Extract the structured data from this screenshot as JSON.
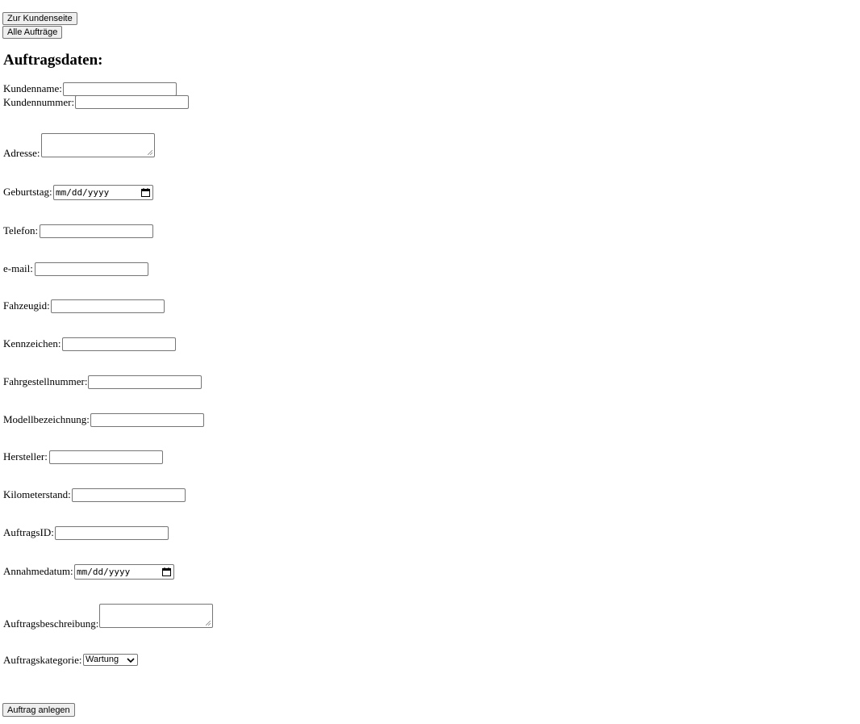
{
  "nav": {
    "customer_page_button": "Zur Kundenseite",
    "all_orders_button": "Alle Aufträge"
  },
  "heading": "Auftragsdaten:",
  "fields": {
    "kundenname": {
      "label": "Kundenname:",
      "value": ""
    },
    "kundennummer": {
      "label": "Kundennummer:",
      "value": ""
    },
    "adresse": {
      "label": "Adresse:",
      "value": ""
    },
    "geburtstag": {
      "label": "Geburtstag:",
      "placeholder": "mm/dd/yyyy"
    },
    "telefon": {
      "label": "Telefon:",
      "value": ""
    },
    "email": {
      "label": "e-mail:",
      "value": ""
    },
    "fahzeugid": {
      "label": "Fahzeugid:",
      "value": ""
    },
    "kennzeichen": {
      "label": "Kennzeichen:",
      "value": ""
    },
    "fahrgestellnummer": {
      "label": "Fahrgestellnummer:",
      "value": ""
    },
    "modellbezeichnung": {
      "label": "Modellbezeichnung:",
      "value": ""
    },
    "hersteller": {
      "label": "Hersteller:",
      "value": ""
    },
    "kilometerstand": {
      "label": "Kilometerstand:",
      "value": ""
    },
    "auftragsid": {
      "label": "AuftragsID:",
      "value": ""
    },
    "annahmedatum": {
      "label": "Annahmedatum:",
      "placeholder": "mm/dd/yyyy"
    },
    "auftragsbeschreibung": {
      "label": "Auftragsbeschreibung:",
      "value": ""
    },
    "auftragskategorie": {
      "label": "Auftragskategorie:",
      "selected": "Wartung"
    }
  },
  "submit_button": "Auftrag anlegen",
  "icons": {
    "date_picker": "calendar-icon",
    "select_arrow": "chevron-down-icon",
    "textarea_resize": "resize-grip-icon"
  }
}
